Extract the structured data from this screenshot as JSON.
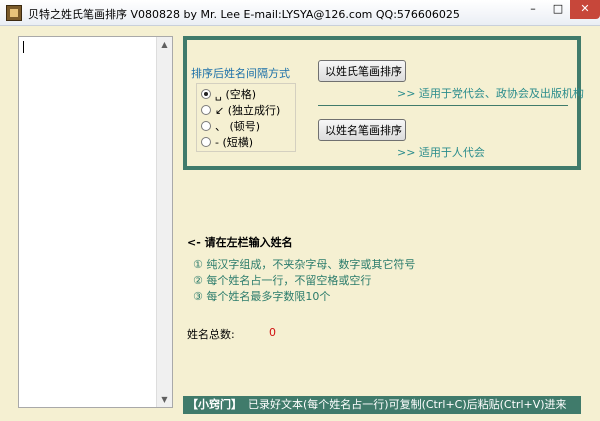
{
  "window": {
    "title": "贝特之姓氏笔画排序  V080828  by Mr. Lee  E-mail:LYSYA@126.com  QQ:576606025",
    "min_glyph": "–",
    "max_glyph": "□",
    "close_glyph": "✕"
  },
  "left_panel": {
    "scroll_up_glyph": "▲",
    "scroll_down_glyph": "▼"
  },
  "options": {
    "label": "排序后姓名间隔方式",
    "radios": [
      {
        "label": "␣ (空格)",
        "checked": true
      },
      {
        "label": "↙ (独立成行)",
        "checked": false
      },
      {
        "label": "、 (顿号)",
        "checked": false
      },
      {
        "label": "- (短横)",
        "checked": false
      }
    ]
  },
  "buttons": {
    "surname_sort": "以姓氏笔画排序",
    "surname_hint": ">> 适用于党代会、政协会及出版机构",
    "fullname_sort": "以姓名笔画排序",
    "fullname_hint": ">> 适用于人代会"
  },
  "instructions": {
    "title": "<- 请在左栏输入姓名",
    "rules": [
      "① 纯汉字组成，不夹杂字母、数字或其它符号",
      "② 每个姓名占一行，不留空格或空行",
      "③ 每个姓名最多字数限10个"
    ]
  },
  "count": {
    "label": "姓名总数:",
    "value": "0"
  },
  "tip": {
    "label": "【小窍门】",
    "text": "已录好文本(每个姓名占一行)可复制(Ctrl+C)后粘贴(Ctrl+V)进来"
  }
}
